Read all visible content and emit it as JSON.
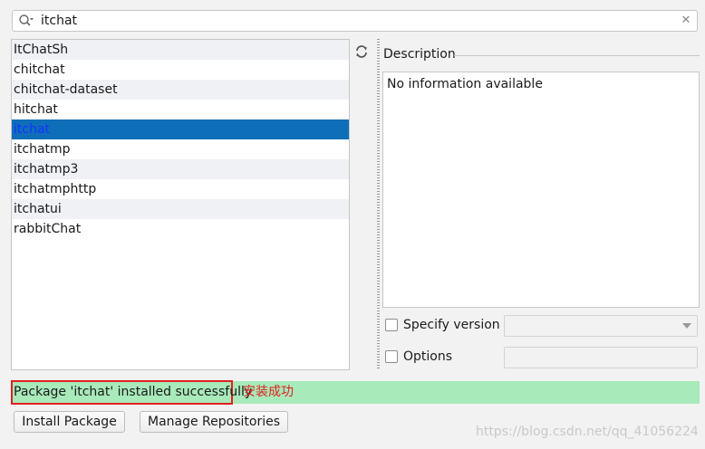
{
  "search": {
    "value": "itchat",
    "clear_icon": "✕"
  },
  "packages": [
    {
      "name": "ItChatSh"
    },
    {
      "name": "chitchat"
    },
    {
      "name": "chitchat-dataset"
    },
    {
      "name": "hitchat"
    },
    {
      "name": "itchat",
      "selected": true
    },
    {
      "name": "itchatmp"
    },
    {
      "name": "itchatmp3"
    },
    {
      "name": "itchatmphttp"
    },
    {
      "name": "itchatui"
    },
    {
      "name": "rabbitChat"
    }
  ],
  "description": {
    "label": "Description",
    "text": "No information available"
  },
  "options": {
    "specify_version_label": "Specify version",
    "specify_version_checked": false,
    "version_value": "",
    "options_label": "Options",
    "options_checked": false,
    "options_value": ""
  },
  "status": {
    "text": "Package 'itchat' installed successfully",
    "annotation": "安装成功"
  },
  "buttons": {
    "install": "Install Package",
    "manage": "Manage Repositories"
  },
  "watermark": "https://blog.csdn.net/qq_41056224",
  "colors": {
    "selection": "#0f6eb9",
    "status_success": "#a8eaba",
    "annotation_red": "#e02020"
  },
  "icons": {
    "search": "search-icon",
    "refresh": "refresh-icon",
    "clear": "clear-icon"
  }
}
